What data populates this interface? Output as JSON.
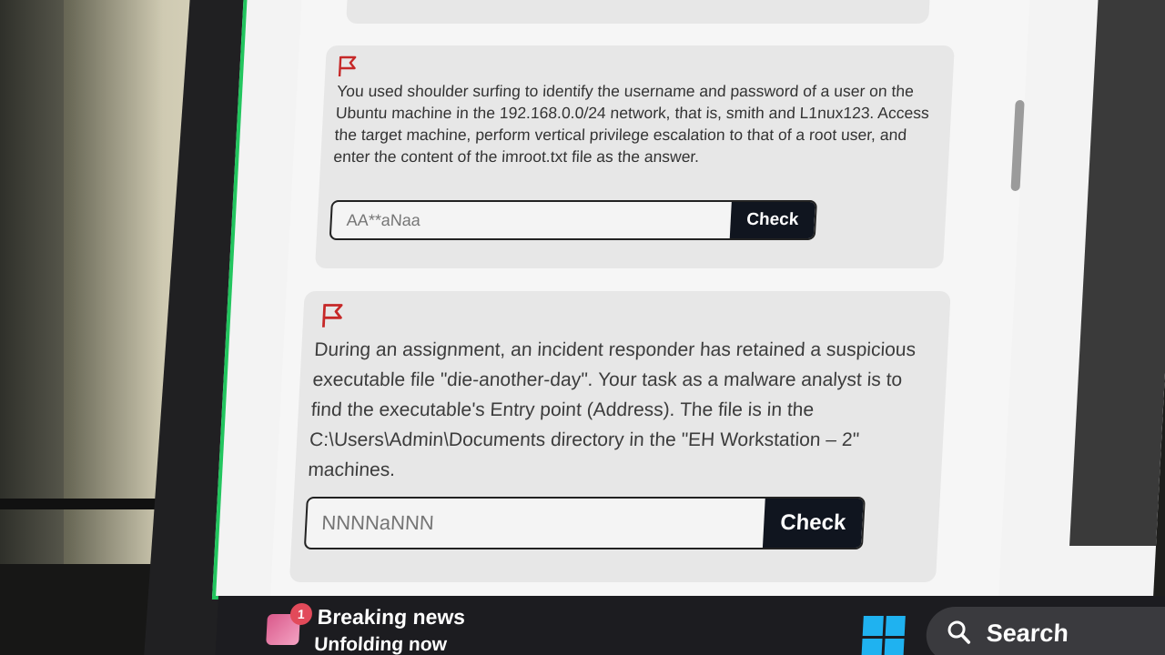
{
  "questions": [
    {
      "icon": "flag-icon",
      "text": "You used shoulder surfing to identify the username and password of a user on the Ubuntu machine in the 192.168.0.0/24 network, that is, smith and L1nux123. Access the target machine, perform vertical privilege escalation to that of a root user, and enter the content of the imroot.txt file as the answer.",
      "answer_placeholder": "AA**aNaa",
      "check_label": "Check"
    },
    {
      "icon": "flag-icon",
      "text": "During an assignment, an incident responder has retained a suspicious executable file \"die-another-day\". Your task as a malware analyst is to find the executable's Entry point (Address). The file is in the C:\\Users\\Admin\\Documents directory in the \"EH Workstation – 2\" machines.",
      "answer_placeholder": "NNNNaNNN",
      "check_label": "Check"
    }
  ],
  "taskbar": {
    "news_badge": "1",
    "news_title": "Breaking news",
    "news_subtitle": "Unfolding now",
    "search_label": "Search"
  },
  "colors": {
    "accent_border": "#22c55e",
    "flag": "#c62828",
    "check_button": "#10151f",
    "windows_logo": "#1fb2f0"
  }
}
